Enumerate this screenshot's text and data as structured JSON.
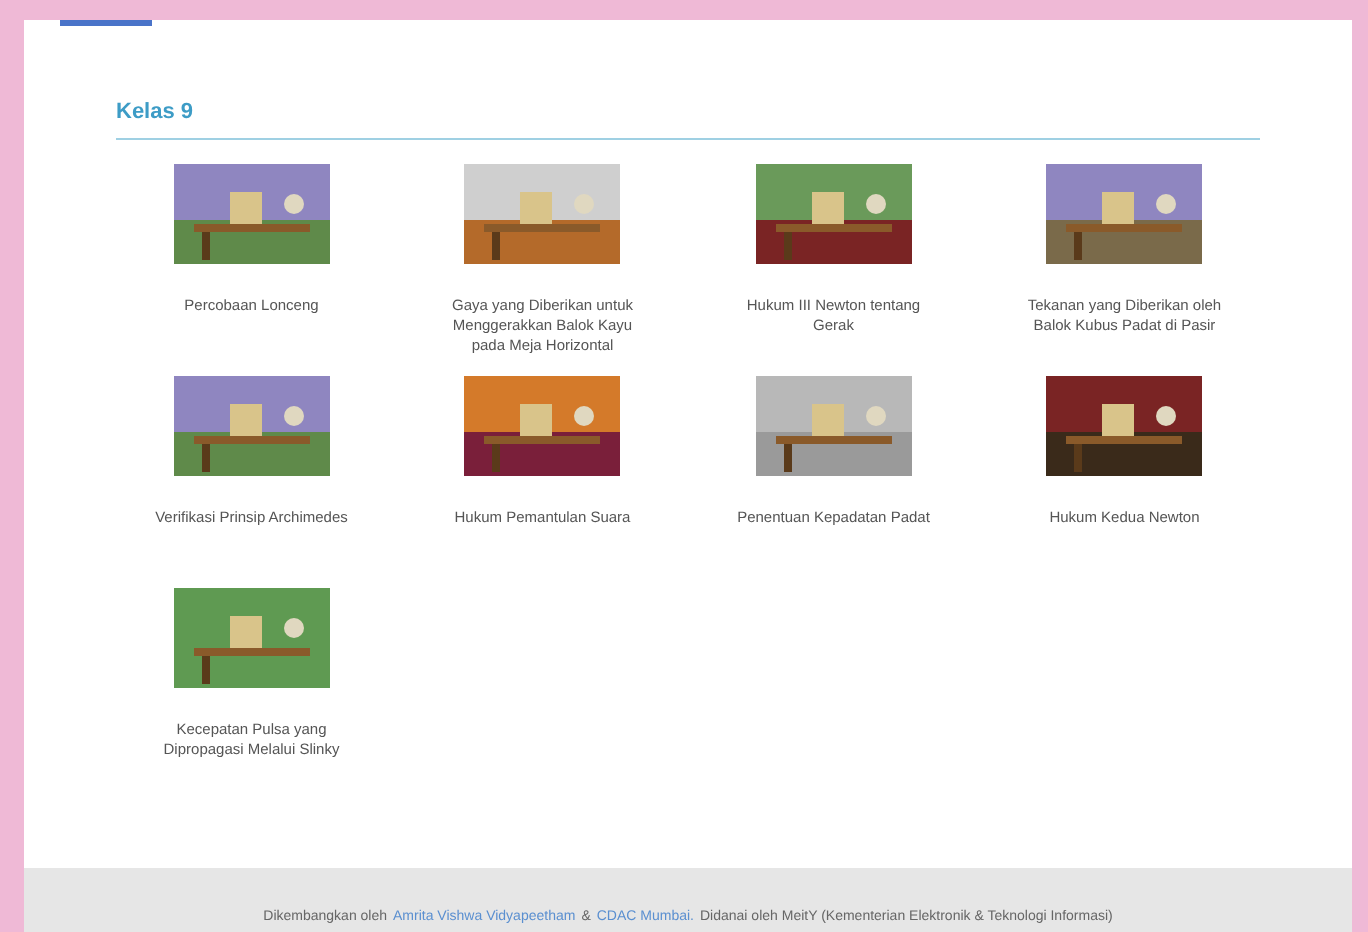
{
  "section": {
    "title": "Kelas 9"
  },
  "experiments": [
    {
      "title": "Percobaan Lonceng"
    },
    {
      "title": "Gaya yang Diberikan untuk Menggerakkan Balok Kayu pada Meja Horizontal"
    },
    {
      "title": "Hukum III Newton tentang Gerak"
    },
    {
      "title": "Tekanan yang Diberikan oleh Balok Kubus Padat di Pasir"
    },
    {
      "title": "Verifikasi Prinsip Archimedes"
    },
    {
      "title": "Hukum Pemantulan Suara"
    },
    {
      "title": "Penentuan Kepadatan Padat"
    },
    {
      "title": "Hukum Kedua Newton"
    },
    {
      "title": "Kecepatan Pulsa yang Dipropagasi Melalui Slinky"
    }
  ],
  "footer": {
    "parts": [
      {
        "kind": "text",
        "text": "Dikembangkan oleh"
      },
      {
        "kind": "link",
        "text": "Amrita Vishwa Vidyapeetham"
      },
      {
        "kind": "text",
        "text": "&"
      },
      {
        "kind": "link",
        "text": "CDAC Mumbai."
      },
      {
        "kind": "text",
        "text": "Didanai oleh MeitY (Kementerian Elektronik & Teknologi Informasi)"
      }
    ]
  }
}
